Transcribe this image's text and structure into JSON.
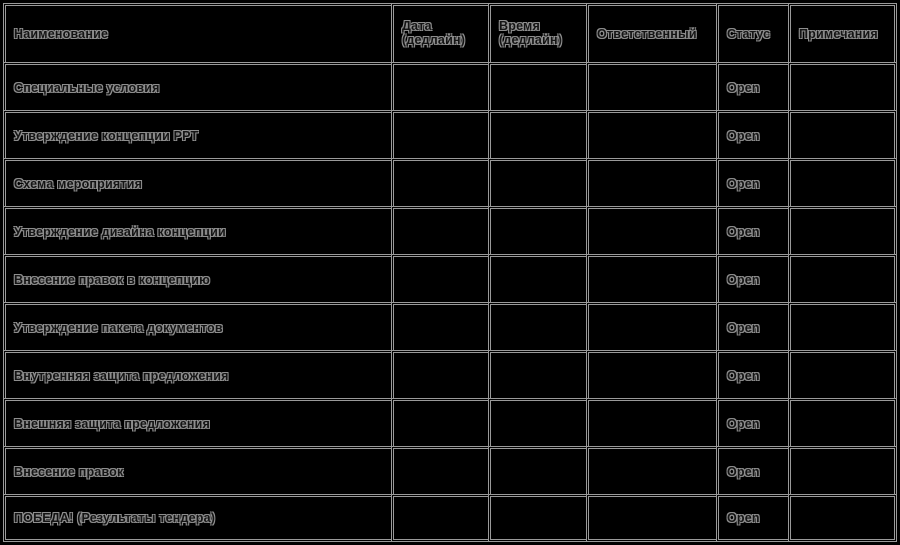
{
  "table": {
    "columns": [
      {
        "key": "name",
        "label": "Наименование",
        "label_lines": [
          "Наименование"
        ]
      },
      {
        "key": "date",
        "label": "Дата (дедлайн)",
        "label_lines": [
          "Дата",
          "(дедлайн)"
        ]
      },
      {
        "key": "time",
        "label": "Время (дедлайн)",
        "label_lines": [
          "Время",
          "(дедлайн)"
        ]
      },
      {
        "key": "resp",
        "label": "Ответственный",
        "label_lines": [
          "Ответственный"
        ]
      },
      {
        "key": "status",
        "label": "Статус",
        "label_lines": [
          "Статус"
        ]
      },
      {
        "key": "notes",
        "label": "Примечания",
        "label_lines": [
          "Примечания"
        ]
      }
    ],
    "rows": [
      {
        "name": "Специальные условия",
        "date": "",
        "time": "",
        "resp": "",
        "status": "Open",
        "notes": ""
      },
      {
        "name": "Утверждение концепции РРТ",
        "date": "",
        "time": "",
        "resp": "",
        "status": "Open",
        "notes": ""
      },
      {
        "name": "Схема мероприятия",
        "date": "",
        "time": "",
        "resp": "",
        "status": "Open",
        "notes": ""
      },
      {
        "name": "Утверждение дизайна концепции",
        "date": "",
        "time": "",
        "resp": "",
        "status": "Open",
        "notes": ""
      },
      {
        "name": "Внесение правок в концепцию",
        "date": "",
        "time": "",
        "resp": "",
        "status": "Open",
        "notes": ""
      },
      {
        "name": "Утверждение пакета документов",
        "date": "",
        "time": "",
        "resp": "",
        "status": "Open",
        "notes": ""
      },
      {
        "name": "Внутренняя защита предложения",
        "date": "",
        "time": "",
        "resp": "",
        "status": "Open",
        "notes": ""
      },
      {
        "name": "Внешняя защита предложения",
        "date": "",
        "time": "",
        "resp": "",
        "status": "Open",
        "notes": ""
      },
      {
        "name": "Внесение правок",
        "date": "",
        "time": "",
        "resp": "",
        "status": "Open",
        "notes": ""
      },
      {
        "name": "ПОБЕДА! (Результаты тендера)",
        "date": "",
        "time": "",
        "resp": "",
        "status": "Open",
        "notes": ""
      }
    ]
  },
  "colors": {
    "background": "#000000",
    "grid": "#9a9a9a",
    "text_fill": "#141414",
    "text_outline": "#8e8e8e"
  }
}
